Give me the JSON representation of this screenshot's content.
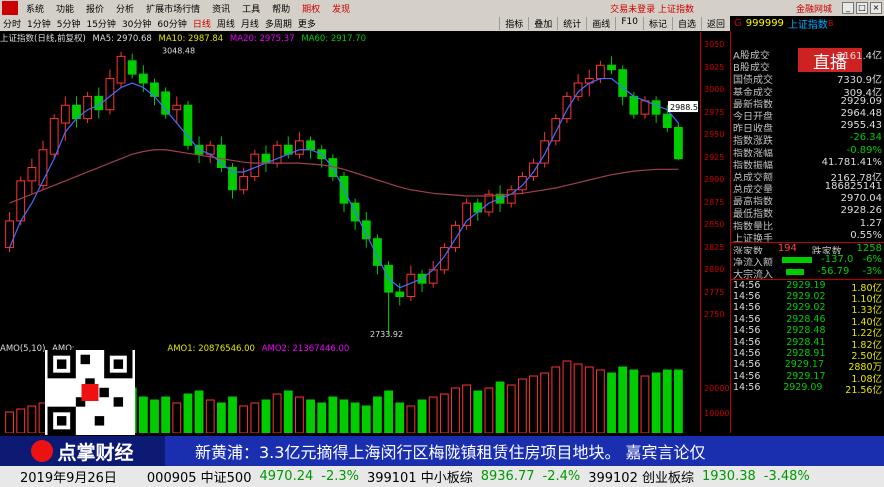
{
  "menu": {
    "items": [
      "系统",
      "功能",
      "报价",
      "分析",
      "扩展市场行情",
      "资讯",
      "工具",
      "帮助"
    ],
    "futures": "期权",
    "invest": "发现",
    "center": "交易未登录 上证指数",
    "brand": "金融网城"
  },
  "periods": {
    "items": [
      "分时",
      "1分钟",
      "5分钟",
      "15分钟",
      "30分钟",
      "60分钟",
      "日线",
      "周线",
      "月线",
      "多周期",
      "更多"
    ],
    "active": "日线"
  },
  "tools": [
    "指标",
    "叠加",
    "统计",
    "画线",
    "F10",
    "标记",
    "自选",
    "返回"
  ],
  "quote": {
    "code": "999999",
    "name": "上证指数",
    "mark": "G",
    "flag": "B"
  },
  "title": {
    "name": "上证指数(日线,前复权)",
    "ma5": "MA5: 2970.68",
    "ma10": "MA10: 2987.84",
    "ma20": "MA20: 2975.37",
    "ma60": "MA60: 2917.70"
  },
  "annot": {
    "high": "3048.48",
    "low": "2733.92",
    "cur": "2988.5"
  },
  "axis": [
    "3050",
    "3025",
    "3000",
    "2975",
    "2950",
    "2925",
    "2900",
    "2875",
    "2850",
    "2825",
    "2800",
    "2775",
    "2750"
  ],
  "vaxis": [
    "20000",
    "10000"
  ],
  "vol": {
    "a": "AMO(5,10)",
    "b": "AMO:",
    "c": "AMO1: 20876546.00",
    "d": "AMO2: 21367446.00"
  },
  "live": "直播",
  "rows": [
    [
      "A股成交",
      "2161.4亿"
    ],
    [
      "B股成交",
      ""
    ],
    [
      "国债成交",
      "7330.9亿"
    ],
    [
      "基金成交",
      "309.4亿"
    ],
    [
      "最新指数",
      "2929.09"
    ],
    [
      "今日开盘",
      "2964.48"
    ],
    [
      "昨日收盘",
      "2955.43"
    ],
    [
      "指数涨跌",
      "-26.34"
    ],
    [
      "指数涨幅",
      "-0.89%"
    ],
    [
      "指数振幅",
      "41.781.41%"
    ],
    [
      "总成交额",
      "2162.78亿"
    ],
    [
      "总成交量",
      "186825141"
    ],
    [
      "最高指数",
      "2970.04"
    ],
    [
      "最低指数",
      "2928.26"
    ],
    [
      "指数量比",
      "1.27"
    ],
    [
      "上证换手",
      "0.55%"
    ]
  ],
  "updown": {
    "up_label": "涨家数",
    "up": "194",
    "down_label": "跌家数",
    "down": "1258"
  },
  "flows": [
    [
      "净流入额",
      "-137.0",
      "-6%"
    ],
    [
      "大宗流入",
      "-56.79",
      "-3%"
    ]
  ],
  "ticks": [
    [
      "14:56",
      "2929.19",
      "1.80亿"
    ],
    [
      "14:56",
      "2929.02",
      "1.10亿"
    ],
    [
      "14:56",
      "2929.02",
      "1.33亿"
    ],
    [
      "14:56",
      "2928.46",
      "1.40亿"
    ],
    [
      "14:56",
      "2928.48",
      "1.22亿"
    ],
    [
      "14:56",
      "2928.41",
      "1.82亿"
    ],
    [
      "14:56",
      "2928.91",
      "2.50亿"
    ],
    [
      "14:56",
      "2929.17",
      "2880万"
    ],
    [
      "14:56",
      "2929.17",
      "1.08亿"
    ],
    [
      "14:56",
      "2929.09",
      "21.56亿"
    ]
  ],
  "ticker": {
    "logo": "点掌财经",
    "text": "新黄浦：3.3亿元摘得上海闵行区梅陇镇租赁住房项目地块。            嘉宾言论仅"
  },
  "bottom": {
    "date": "2019年9月26日",
    "items": [
      [
        "000905 中证500",
        "4970.24",
        "-2.3%"
      ],
      [
        "399101 中小板综",
        "8936.77",
        "-2.4%"
      ],
      [
        "399102 创业板综",
        "1930.38",
        "-3.48%"
      ]
    ]
  },
  "chart_data": {
    "type": "candlestick",
    "ymin": 2725,
    "ymax": 3060,
    "candles": [
      [
        2830,
        2860,
        2825,
        2870
      ],
      [
        2860,
        2905,
        2855,
        2910
      ],
      [
        2905,
        2920,
        2890,
        2930
      ],
      [
        2900,
        2940,
        2895,
        2950
      ],
      [
        2935,
        2975,
        2930,
        2980
      ],
      [
        2970,
        2990,
        2950,
        3000
      ],
      [
        2990,
        2975,
        2965,
        3000
      ],
      [
        2975,
        3000,
        2970,
        3005
      ],
      [
        3000,
        2985,
        2975,
        3010
      ],
      [
        2985,
        3020,
        2980,
        3030
      ],
      [
        3015,
        3045,
        3010,
        3050
      ],
      [
        3040,
        3025,
        3020,
        3048
      ],
      [
        3025,
        3015,
        3005,
        3035
      ],
      [
        3015,
        3000,
        2990,
        3020
      ],
      [
        3005,
        2980,
        2975,
        3010
      ],
      [
        2985,
        2990,
        2970,
        3000
      ],
      [
        2990,
        2945,
        2940,
        2995
      ],
      [
        2945,
        2935,
        2925,
        2955
      ],
      [
        2935,
        2945,
        2925,
        2950
      ],
      [
        2945,
        2920,
        2915,
        2955
      ],
      [
        2920,
        2895,
        2885,
        2925
      ],
      [
        2895,
        2910,
        2890,
        2920
      ],
      [
        2910,
        2935,
        2905,
        2940
      ],
      [
        2935,
        2925,
        2915,
        2945
      ],
      [
        2925,
        2945,
        2920,
        2950
      ],
      [
        2945,
        2935,
        2930,
        2955
      ],
      [
        2935,
        2950,
        2930,
        2960
      ],
      [
        2950,
        2940,
        2930,
        2955
      ],
      [
        2940,
        2930,
        2920,
        2945
      ],
      [
        2930,
        2910,
        2905,
        2935
      ],
      [
        2910,
        2880,
        2870,
        2915
      ],
      [
        2880,
        2860,
        2850,
        2885
      ],
      [
        2860,
        2840,
        2830,
        2870
      ],
      [
        2840,
        2810,
        2800,
        2845
      ],
      [
        2810,
        2780,
        2734,
        2815
      ],
      [
        2780,
        2775,
        2765,
        2790
      ],
      [
        2775,
        2800,
        2770,
        2810
      ],
      [
        2800,
        2790,
        2780,
        2805
      ],
      [
        2790,
        2805,
        2785,
        2815
      ],
      [
        2805,
        2830,
        2800,
        2835
      ],
      [
        2830,
        2855,
        2825,
        2860
      ],
      [
        2855,
        2880,
        2850,
        2885
      ],
      [
        2880,
        2870,
        2860,
        2885
      ],
      [
        2870,
        2890,
        2865,
        2895
      ],
      [
        2890,
        2880,
        2870,
        2900
      ],
      [
        2880,
        2895,
        2875,
        2900
      ],
      [
        2895,
        2910,
        2890,
        2915
      ],
      [
        2910,
        2925,
        2905,
        2930
      ],
      [
        2925,
        2950,
        2920,
        2960
      ],
      [
        2950,
        2975,
        2945,
        2980
      ],
      [
        2975,
        3000,
        2970,
        3005
      ],
      [
        3000,
        3015,
        2995,
        3025
      ],
      [
        3015,
        3020,
        3000,
        3030
      ],
      [
        3020,
        3035,
        3015,
        3040
      ],
      [
        3035,
        3030,
        3025,
        3045
      ],
      [
        3030,
        3000,
        2990,
        3035
      ],
      [
        3000,
        2980,
        2975,
        3005
      ],
      [
        2980,
        2995,
        2975,
        3000
      ],
      [
        2995,
        2980,
        2970,
        3000
      ],
      [
        2980,
        2965,
        2960,
        2990
      ],
      [
        2965,
        2930,
        2928,
        2970
      ]
    ],
    "volumes": [
      7,
      8,
      9,
      10,
      11,
      12,
      11,
      10,
      13,
      14,
      16,
      15,
      12,
      11,
      12,
      10,
      13,
      14,
      11,
      10,
      12,
      9,
      10,
      11,
      13,
      14,
      12,
      11,
      10,
      12,
      11,
      10,
      9,
      12,
      14,
      10,
      9,
      11,
      12,
      13,
      15,
      16,
      14,
      15,
      17,
      16,
      18,
      19,
      20,
      22,
      24,
      23,
      22,
      21,
      20,
      22,
      21,
      19,
      20,
      21,
      21
    ],
    "ma_fast": [
      2830,
      2860,
      2880,
      2905,
      2930,
      2960,
      2975,
      2985,
      2990,
      3000,
      3010,
      3015,
      3010,
      3000,
      2985,
      2970,
      2955,
      2940,
      2935,
      2925,
      2915,
      2915,
      2920,
      2925,
      2930,
      2935,
      2940,
      2940,
      2935,
      2920,
      2895,
      2870,
      2845,
      2820,
      2795,
      2785,
      2790,
      2795,
      2805,
      2820,
      2840,
      2860,
      2870,
      2880,
      2885,
      2890,
      2900,
      2915,
      2935,
      2960,
      2985,
      3005,
      3015,
      3020,
      3020,
      3010,
      3000,
      2995,
      2990,
      2985,
      2970
    ],
    "ma_slow": [
      2880,
      2885,
      2890,
      2895,
      2900,
      2905,
      2910,
      2915,
      2920,
      2925,
      2930,
      2935,
      2938,
      2940,
      2940,
      2938,
      2936,
      2934,
      2932,
      2930,
      2928,
      2926,
      2925,
      2925,
      2925,
      2925,
      2925,
      2924,
      2923,
      2921,
      2918,
      2914,
      2910,
      2906,
      2902,
      2898,
      2895,
      2893,
      2891,
      2890,
      2889,
      2888,
      2888,
      2888,
      2889,
      2890,
      2891,
      2893,
      2895,
      2897,
      2900,
      2903,
      2906,
      2909,
      2912,
      2914,
      2916,
      2917,
      2918,
      2918,
      2918
    ]
  }
}
